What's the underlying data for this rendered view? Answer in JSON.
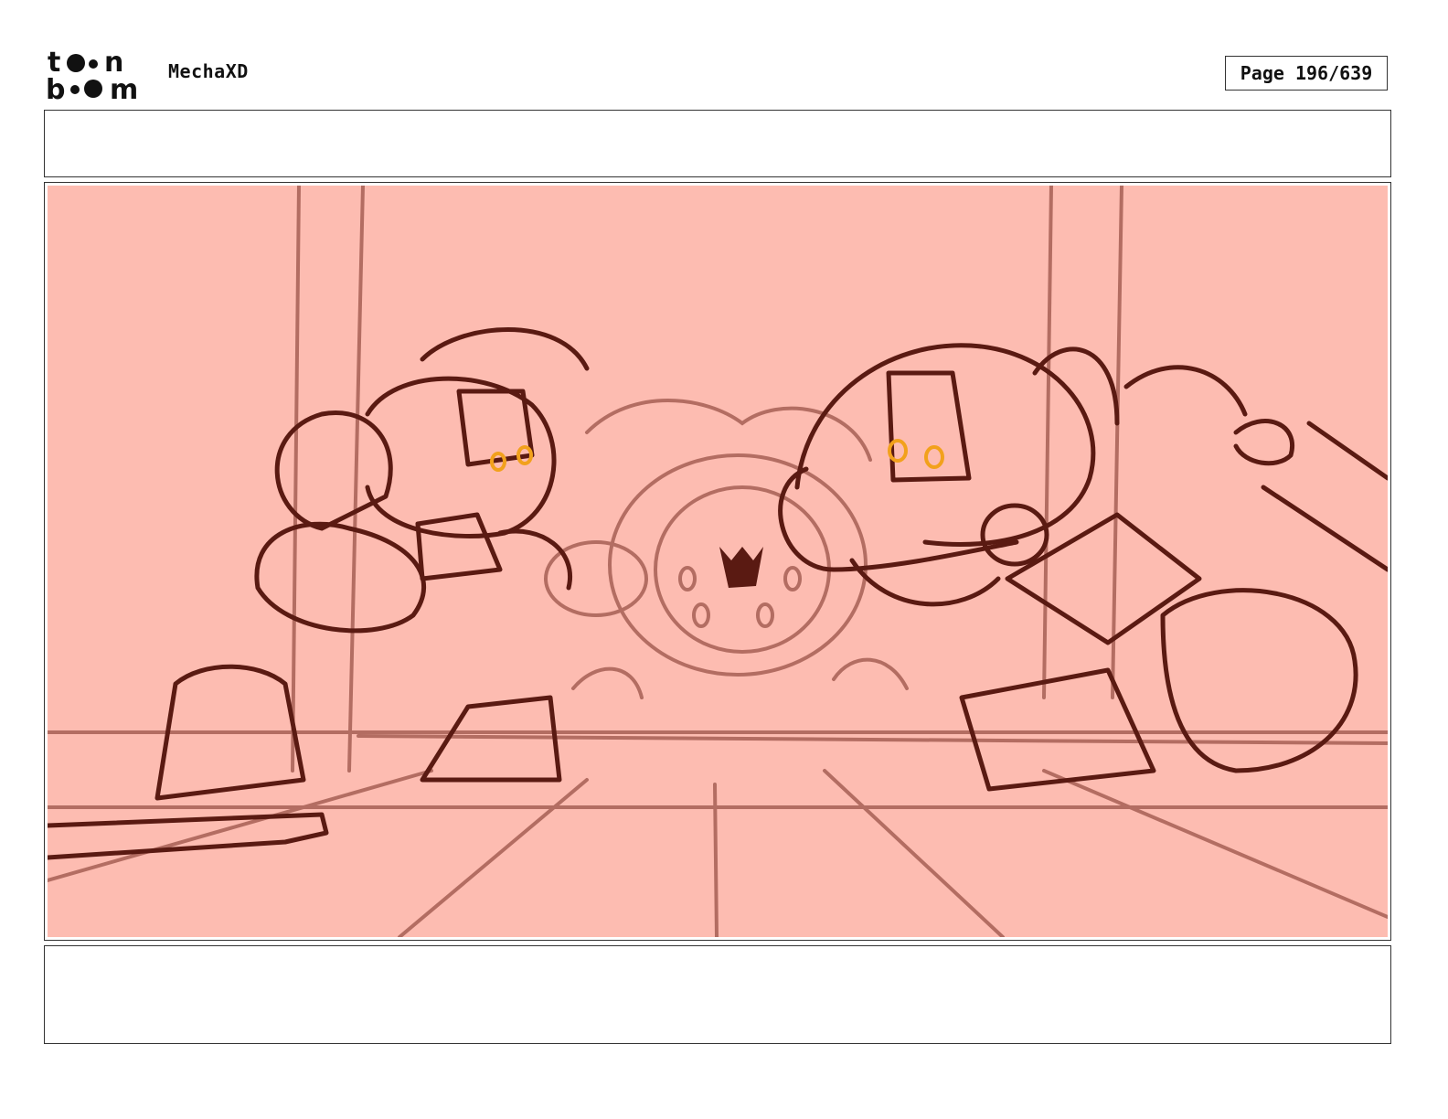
{
  "header": {
    "logo_text": "toon boom",
    "project_title": "MechaXD",
    "page_label": "Page 196/639"
  },
  "panel": {
    "background_color": "#fdbcb1",
    "line_color_dark": "#5a1a12",
    "line_color_light": "#b36d62",
    "accent_eye_color": "#f2a11c"
  },
  "notes": {
    "top_text": "",
    "bottom_text": ""
  }
}
